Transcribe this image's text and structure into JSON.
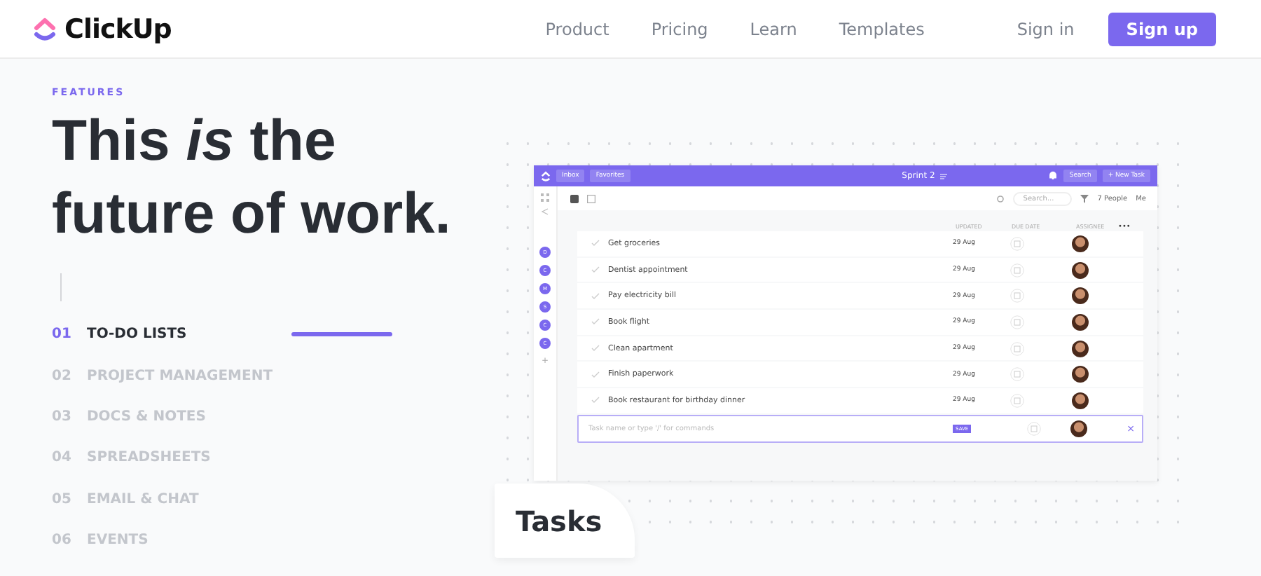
{
  "header": {
    "logo": "ClickUp",
    "nav": [
      "Product",
      "Pricing",
      "Learn",
      "Templates"
    ],
    "sign_in": "Sign in",
    "sign_up": "Sign up"
  },
  "hero": {
    "eyebrow": "FEATURES",
    "title": "This *is* the future of work."
  },
  "features": [
    {
      "number": "01",
      "label": "TO-DO LISTS",
      "selected": true
    },
    {
      "number": "02",
      "label": "PROJECT MANAGEMENT",
      "selected": false
    },
    {
      "number": "03",
      "label": "DOCS & NOTES",
      "selected": false
    },
    {
      "number": "04",
      "label": "SPREADSHEETS",
      "selected": false
    },
    {
      "number": "05",
      "label": "EMAIL & CHAT",
      "selected": false
    },
    {
      "number": "06",
      "label": "EVENTS",
      "selected": false
    }
  ],
  "app": {
    "topbar": {
      "inbox": "Inbox",
      "favorites": "Favorites",
      "title": "Sprint 2",
      "search": "Search",
      "new_task": "+ New Task"
    },
    "toolbar": {
      "search_placeholder": "Search...",
      "people": "7 People",
      "me": "Me"
    },
    "rail": {
      "avatars": [
        "D",
        "C",
        "M",
        "S",
        "C",
        "C"
      ],
      "add": "+"
    },
    "columns": [
      "UPDATED",
      "DUE DATE",
      "ASSIGNEE"
    ],
    "more": "•••",
    "tasks": [
      {
        "name": "Get groceries",
        "updated": "29 Aug"
      },
      {
        "name": "Dentist appointment",
        "updated": "29 Aug"
      },
      {
        "name": "Pay electricity bill",
        "updated": "29 Aug"
      },
      {
        "name": "Book flight",
        "updated": "29 Aug"
      },
      {
        "name": "Clean apartment",
        "updated": "29 Aug"
      },
      {
        "name": "Finish paperwork",
        "updated": "29 Aug"
      },
      {
        "name": "Book restaurant for birthday dinner",
        "updated": "29 Aug"
      }
    ],
    "new_task": {
      "placeholder": "Task name or type '/' for commands",
      "save": "SAVE",
      "close": "×"
    }
  },
  "badge": "Tasks"
}
